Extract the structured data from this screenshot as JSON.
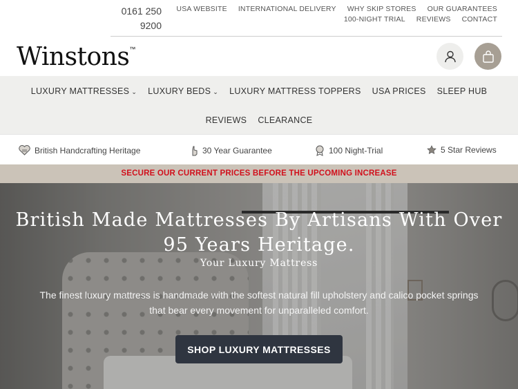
{
  "header": {
    "phone": "0161 250 9200",
    "top_links_row1": [
      "USA WEBSITE",
      "INTERNATIONAL DELIVERY",
      "WHY SKIP STORES",
      "OUR GUARANTEES"
    ],
    "top_links_row2": [
      "100-NIGHT TRIAL",
      "REVIEWS",
      "CONTACT"
    ],
    "logo": "Winstons",
    "logo_tm": "™",
    "account_icon": "user-icon",
    "bag_icon": "shopping-bag-icon"
  },
  "nav": {
    "items": [
      {
        "label": "LUXURY MATTRESSES",
        "dropdown": true
      },
      {
        "label": "LUXURY BEDS",
        "dropdown": true
      },
      {
        "label": "LUXURY MATTRESS TOPPERS",
        "dropdown": false
      },
      {
        "label": "USA PRICES",
        "dropdown": false
      },
      {
        "label": "SLEEP HUB",
        "dropdown": false
      },
      {
        "label": "REVIEWS",
        "dropdown": false
      },
      {
        "label": "CLEARANCE",
        "dropdown": false
      }
    ]
  },
  "usps": [
    {
      "icon": "heart-icon",
      "label": "British Handcrafting Heritage"
    },
    {
      "icon": "hand-icon",
      "label": "30 Year Guarantee"
    },
    {
      "icon": "badge-icon",
      "label": "100 Night-Trial"
    },
    {
      "icon": "star-icon",
      "label": "5 Star Reviews"
    }
  ],
  "promo": {
    "text": "SECURE OUR CURRENT PRICES BEFORE THE UPCOMING INCREASE",
    "color": "#d1101c"
  },
  "hero": {
    "title": "British Made Mattresses By Artisans With Over 95 Years Heritage.",
    "subtitle": "Your Luxury Mattress",
    "description": "The finest luxury mattress is handmade with the softest natural fill upholstery and calico pocket springs that bear every movement for unparalleled comfort.",
    "cta_label": "SHOP LUXURY MATTRESSES"
  },
  "colors": {
    "nav_bg": "#efefed",
    "promo_bg": "#cbc3b8",
    "bag_button": "#a79f94",
    "cta_bg": "#2f3540"
  }
}
